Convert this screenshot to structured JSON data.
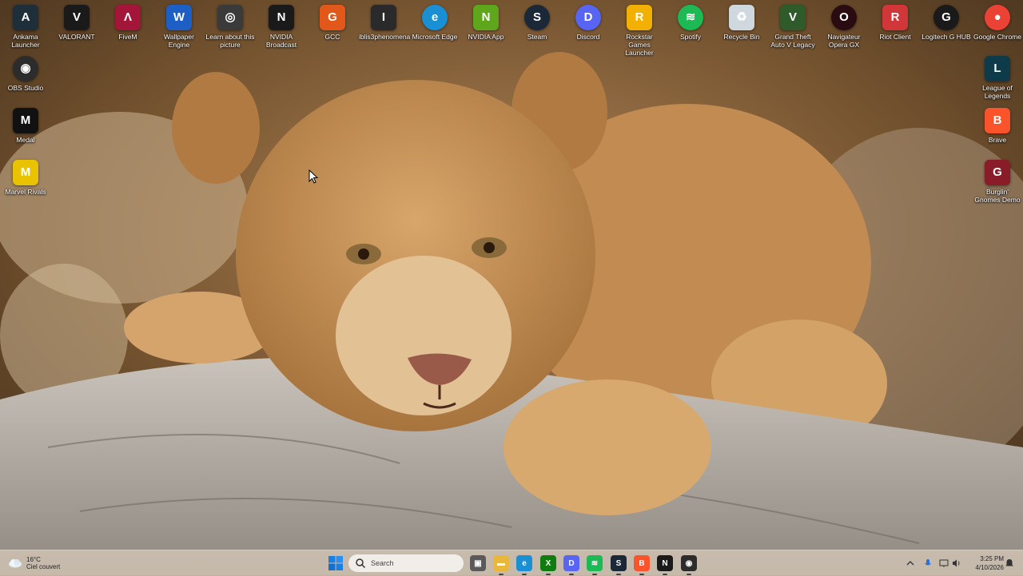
{
  "desktop": {
    "icons": [
      {
        "label": "Ankama Launcher",
        "icon": "ankama-icon",
        "color": "#1f2f3a",
        "glyph": "A"
      },
      {
        "label": "VALORANT",
        "icon": "valorant-icon",
        "color": "#1a1a1a",
        "glyph": "V"
      },
      {
        "label": "FiveM",
        "icon": "fivem-icon",
        "color": "#a3163a",
        "glyph": "Λ"
      },
      {
        "label": "Wallpaper Engine",
        "icon": "wallpaper-engine-icon",
        "color": "#1d5fc4",
        "glyph": "W"
      },
      {
        "label": "Learn about this picture",
        "icon": "learn-picture-icon",
        "color": "#3a3a3a",
        "glyph": "◎"
      },
      {
        "label": "NVIDIA Broadcast",
        "icon": "nvidia-broadcast-icon",
        "color": "#1a1a1a",
        "glyph": "N"
      },
      {
        "label": "GCC",
        "icon": "gcc-icon",
        "color": "#e2581b",
        "glyph": "G"
      },
      {
        "label": "iblis3phenomena",
        "icon": "iblis-icon",
        "color": "#2a2a2a",
        "glyph": "I"
      },
      {
        "label": "Microsoft Edge",
        "icon": "edge-icon",
        "color": "#1a8fd4",
        "glyph": "e"
      },
      {
        "label": "NVIDIA App",
        "icon": "nvidia-app-icon",
        "color": "#5ea61c",
        "glyph": "N"
      },
      {
        "label": "Steam",
        "icon": "steam-icon",
        "color": "#1b2838",
        "glyph": "S"
      },
      {
        "label": "Discord",
        "icon": "discord-icon",
        "color": "#5865f2",
        "glyph": "D"
      },
      {
        "label": "Rockstar Games Launcher",
        "icon": "rockstar-icon",
        "color": "#f2b100",
        "glyph": "R"
      },
      {
        "label": "Spotify",
        "icon": "spotify-icon",
        "color": "#1db954",
        "glyph": "≋"
      },
      {
        "label": "Recycle Bin",
        "icon": "recycle-bin-icon",
        "color": "#cfd8de",
        "glyph": "♻"
      },
      {
        "label": "Grand Theft Auto V Legacy",
        "icon": "gta-v-icon",
        "color": "#2f5a2a",
        "glyph": "V"
      },
      {
        "label": "Navigateur Opera GX",
        "icon": "opera-gx-icon",
        "color": "#2a0b12",
        "glyph": "O"
      },
      {
        "label": "Riot Client",
        "icon": "riot-client-icon",
        "color": "#d13639",
        "glyph": "R"
      },
      {
        "label": "Logitech G HUB",
        "icon": "logitech-ghub-icon",
        "color": "#1a1a1a",
        "glyph": "G"
      },
      {
        "label": "Google Chrome",
        "icon": "chrome-icon",
        "color": "#ea4335",
        "glyph": "●"
      },
      {
        "label": "OBS Studio",
        "icon": "obs-icon",
        "color": "#2c2c2c",
        "glyph": "◉"
      },
      {
        "label": "Medal",
        "icon": "medal-icon",
        "color": "#111111",
        "glyph": "M"
      },
      {
        "label": "Marvel Rivals",
        "icon": "marvel-rivals-icon",
        "color": "#e9c200",
        "glyph": "M"
      },
      {
        "label": "League of Legends",
        "icon": "league-of-legends-icon",
        "color": "#0d3b4a",
        "glyph": "L"
      },
      {
        "label": "Brave",
        "icon": "brave-icon",
        "color": "#fb542b",
        "glyph": "B"
      },
      {
        "label": "Burglin' Gnomes Demo",
        "icon": "burglin-gnomes-icon",
        "color": "#8a1c2a",
        "glyph": "G"
      }
    ]
  },
  "taskbar": {
    "weather": {
      "temp": "16°C",
      "condition": "Ciel couvert"
    },
    "search": {
      "placeholder": "Search"
    },
    "apps": [
      {
        "name": "task-view-icon",
        "color": "#5a5a5a",
        "glyph": "▣"
      },
      {
        "name": "file-explorer-icon",
        "color": "#e8b73c",
        "glyph": "▬"
      },
      {
        "name": "edge-icon",
        "color": "#1a8fd4",
        "glyph": "e"
      },
      {
        "name": "xbox-icon",
        "color": "#107c10",
        "glyph": "X"
      },
      {
        "name": "discord-icon",
        "color": "#5865f2",
        "glyph": "D"
      },
      {
        "name": "spotify-icon",
        "color": "#1db954",
        "glyph": "≋"
      },
      {
        "name": "steam-icon",
        "color": "#1b2838",
        "glyph": "S"
      },
      {
        "name": "brave-icon",
        "color": "#fb542b",
        "glyph": "B"
      },
      {
        "name": "nvidia-broadcast-icon",
        "color": "#1a1a1a",
        "glyph": "N"
      },
      {
        "name": "obs-icon",
        "color": "#2c2c2c",
        "glyph": "◉"
      }
    ],
    "clock": {
      "time": "3:25 PM",
      "date": "4/10/2026"
    }
  }
}
